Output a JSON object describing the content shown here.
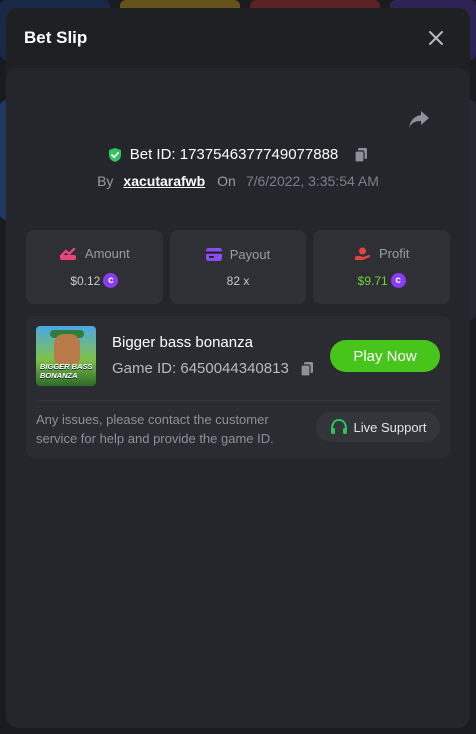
{
  "modal": {
    "title": "Bet Slip"
  },
  "bet": {
    "id_label": "Bet ID: 1737546377749077888",
    "by_label": "By",
    "username": "xacutarafwb",
    "on_label": "On",
    "date": "7/6/2022, 3:35:54 AM"
  },
  "stats": {
    "amount": {
      "label": "Amount",
      "value": "$0.12"
    },
    "payout": {
      "label": "Payout",
      "value": "82 x"
    },
    "profit": {
      "label": "Profit",
      "value": "$9.71"
    }
  },
  "game": {
    "name": "Bigger bass bonanza",
    "id_label": "Game ID: 6450044340813",
    "thumbnail_text": "BIGGER BASS BONANZA",
    "play_label": "Play Now"
  },
  "support": {
    "text": "Any issues, please contact the customer service for help and provide the game ID.",
    "button_label": "Live Support"
  },
  "colors": {
    "accent_green": "#47c51a",
    "profit_green": "#6fd43a",
    "coin_purple": "#8b3bf0",
    "amount_pink": "#e8457a",
    "payout_purple": "#8a4df0",
    "profit_red": "#e0453c",
    "verified_green": "#2ec45a"
  }
}
